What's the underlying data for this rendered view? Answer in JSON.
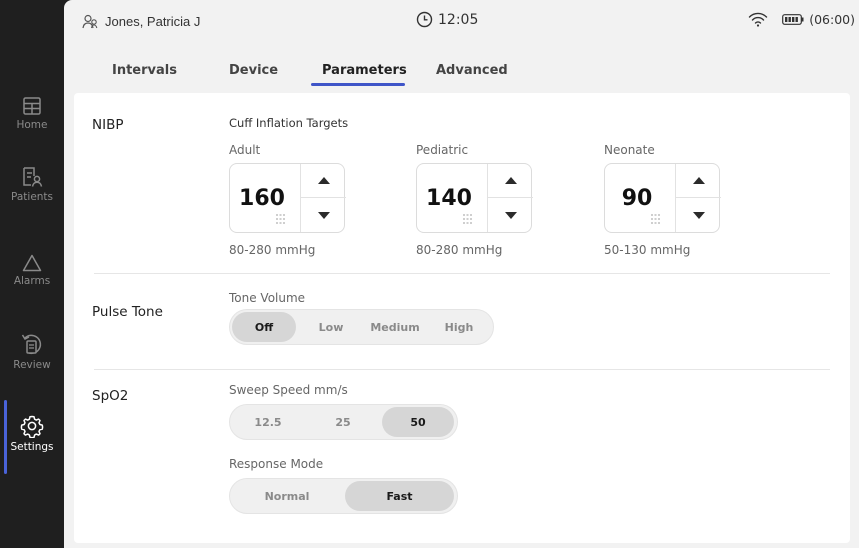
{
  "sidebar": {
    "items": [
      {
        "label": "Home",
        "icon": "home-icon"
      },
      {
        "label": "Patients",
        "icon": "patients-icon"
      },
      {
        "label": "Alarms",
        "icon": "alarm-icon"
      },
      {
        "label": "Review",
        "icon": "review-icon"
      },
      {
        "label": "Settings",
        "icon": "gear-icon"
      }
    ],
    "active": "Settings",
    "accent": "#4a63d8"
  },
  "header": {
    "patient_name": "Jones, Patricia J",
    "time": "12:05",
    "battery_text": "(06:00)"
  },
  "tabs": {
    "items": [
      "Intervals",
      "Device",
      "Parameters",
      "Advanced"
    ],
    "active": "Parameters"
  },
  "nibp": {
    "title": "NIBP",
    "subtitle": "Cuff Inflation Targets",
    "adult": {
      "label": "Adult",
      "value": "160",
      "range": "80-280 mmHg"
    },
    "pediatric": {
      "label": "Pediatric",
      "value": "140",
      "range": "80-280 mmHg"
    },
    "neonate": {
      "label": "Neonate",
      "value": "90",
      "range": "50-130 mmHg"
    }
  },
  "pulse_tone": {
    "title": "Pulse Tone",
    "volume_label": "Tone Volume",
    "options": [
      "Off",
      "Low",
      "Medium",
      "High"
    ],
    "selected": "Off"
  },
  "spo2": {
    "title": "SpO2",
    "sweep_label": "Sweep Speed mm/s",
    "sweep_options": [
      "12.5",
      "25",
      "50"
    ],
    "sweep_selected": "50",
    "response_label": "Response Mode",
    "response_options": [
      "Normal",
      "Fast"
    ],
    "response_selected": "Fast"
  }
}
